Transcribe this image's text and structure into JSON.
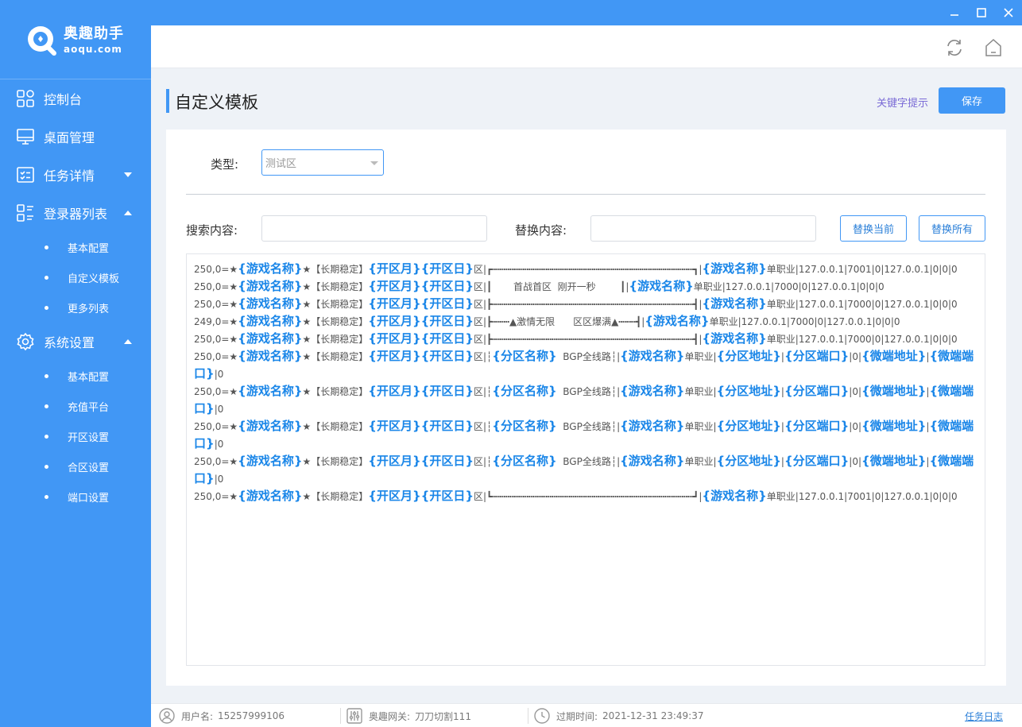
{
  "app": {
    "logo_cn": "奥趣助手",
    "logo_en": "aoqu.com"
  },
  "sidebar": {
    "items": [
      {
        "label": "控制台",
        "icon": "dashboard-icon"
      },
      {
        "label": "桌面管理",
        "icon": "monitor-icon"
      },
      {
        "label": "任务详情",
        "icon": "task-list-icon",
        "expanded": false
      },
      {
        "label": "登录器列表",
        "icon": "list-icon",
        "expanded": true,
        "children": [
          "基本配置",
          "自定义模板",
          "更多列表"
        ]
      },
      {
        "label": "系统设置",
        "icon": "gear-icon",
        "expanded": true,
        "children": [
          "基本配置",
          "充值平台",
          "开区设置",
          "合区设置",
          "端口设置"
        ]
      }
    ]
  },
  "page": {
    "title": "自定义模板",
    "keyword_hint": "关键字提示",
    "save_label": "保存"
  },
  "form": {
    "type_label": "类型:",
    "type_value": "测试区",
    "search_label": "搜索内容:",
    "search_value": "",
    "replace_label": "替换内容:",
    "replace_value": "",
    "replace_current_label": "替换当前",
    "replace_all_label": "替换所有"
  },
  "editor": {
    "lines": [
      [
        [
          "t",
          "250,0=★"
        ],
        [
          "k",
          "{游戏名称}"
        ],
        [
          "t",
          "★【长期稳定】"
        ],
        [
          "k",
          "{开区月}{开区日}"
        ],
        [
          "t",
          "区|┏┅┅┅┅┅┅┅┅┅┅┅┅┅┅┅┅┅┅┅┅┅┅┅┅┅┅┅┅┅┅┅┅┅┅┅┓|"
        ],
        [
          "k",
          "{游戏名称}"
        ],
        [
          "t",
          "单职业|127.0.0.1|7001|0|127.0.0.1|0|0|0"
        ]
      ],
      [
        [
          "t",
          "250,0=★"
        ],
        [
          "k",
          "{游戏名称}"
        ],
        [
          "t",
          "★【长期稳定】"
        ],
        [
          "k",
          "{开区月}{开区日}"
        ],
        [
          "t",
          "区|┃       首战首区  刚开一秒        ┃|"
        ],
        [
          "k",
          "{游戏名称}"
        ],
        [
          "t",
          "单职业|127.0.0.1|7000|0|127.0.0.1|0|0|0"
        ]
      ],
      [
        [
          "t",
          "250,0=★"
        ],
        [
          "k",
          "{游戏名称}"
        ],
        [
          "t",
          "★【长期稳定】"
        ],
        [
          "k",
          "{开区月}{开区日}"
        ],
        [
          "t",
          "区|┣┅┅┅┅┅┅┅┅┅┅┅┅┅┅┅┅┅┅┅┅┅┅┅┅┅┅┅┅┅┅┅┅┅┅┅┫|"
        ],
        [
          "k",
          "{游戏名称}"
        ],
        [
          "t",
          "单职业|127.0.0.1|7000|0|127.0.0.1|0|0|0"
        ]
      ],
      [
        [
          "t",
          "249,0=★"
        ],
        [
          "k",
          "{游戏名称}"
        ],
        [
          "t",
          "★【长期稳定】"
        ],
        [
          "k",
          "{开区月}{开区日}"
        ],
        [
          "t",
          "区|┣┅┅┅▲激情无限      区区爆满▲┅┅┅┫|"
        ],
        [
          "k",
          "{游戏名称}"
        ],
        [
          "t",
          "单职业|127.0.0.1|7000|0|127.0.0.1|0|0|0"
        ]
      ],
      [
        [
          "t",
          "250,0=★"
        ],
        [
          "k",
          "{游戏名称}"
        ],
        [
          "t",
          "★【长期稳定】"
        ],
        [
          "k",
          "{开区月}{开区日}"
        ],
        [
          "t",
          "区|┣┅┅┅┅┅┅┅┅┅┅┅┅┅┅┅┅┅┅┅┅┅┅┅┅┅┅┅┅┅┅┅┅┅┅┅┫|"
        ],
        [
          "k",
          "{游戏名称}"
        ],
        [
          "t",
          "单职业|127.0.0.1|7000|0|127.0.0.1|0|0|0"
        ]
      ],
      [
        [
          "t",
          "250,0=★"
        ],
        [
          "k",
          "{游戏名称}"
        ],
        [
          "t",
          "★【长期稳定】"
        ],
        [
          "k",
          "{开区月}{开区日}"
        ],
        [
          "t",
          "区|┆"
        ],
        [
          "k",
          "{分区名称}"
        ],
        [
          "t",
          "  BGP全线路┆|"
        ],
        [
          "k",
          "{游戏名称}"
        ],
        [
          "t",
          "单职业|"
        ],
        [
          "k",
          "{分区地址}"
        ],
        [
          "t",
          "|"
        ],
        [
          "k",
          "{分区端口}"
        ],
        [
          "t",
          "|0|"
        ],
        [
          "k",
          "{微端地址}"
        ],
        [
          "t",
          "|"
        ],
        [
          "k",
          "{微端端口}"
        ],
        [
          "t",
          "|0"
        ]
      ],
      [
        [
          "t",
          "250,0=★"
        ],
        [
          "k",
          "{游戏名称}"
        ],
        [
          "t",
          "★【长期稳定】"
        ],
        [
          "k",
          "{开区月}{开区日}"
        ],
        [
          "t",
          "区|┆"
        ],
        [
          "k",
          "{分区名称}"
        ],
        [
          "t",
          "  BGP全线路┆|"
        ],
        [
          "k",
          "{游戏名称}"
        ],
        [
          "t",
          "单职业|"
        ],
        [
          "k",
          "{分区地址}"
        ],
        [
          "t",
          "|"
        ],
        [
          "k",
          "{分区端口}"
        ],
        [
          "t",
          "|0|"
        ],
        [
          "k",
          "{微端地址}"
        ],
        [
          "t",
          "|"
        ],
        [
          "k",
          "{微端端口}"
        ],
        [
          "t",
          "|0"
        ]
      ],
      [
        [
          "t",
          "250,0=★"
        ],
        [
          "k",
          "{游戏名称}"
        ],
        [
          "t",
          "★【长期稳定】"
        ],
        [
          "k",
          "{开区月}{开区日}"
        ],
        [
          "t",
          "区|┆"
        ],
        [
          "k",
          "{分区名称}"
        ],
        [
          "t",
          "  BGP全线路┆|"
        ],
        [
          "k",
          "{游戏名称}"
        ],
        [
          "t",
          "单职业|"
        ],
        [
          "k",
          "{分区地址}"
        ],
        [
          "t",
          "|"
        ],
        [
          "k",
          "{分区端口}"
        ],
        [
          "t",
          "|0|"
        ],
        [
          "k",
          "{微端地址}"
        ],
        [
          "t",
          "|"
        ],
        [
          "k",
          "{微端端口}"
        ],
        [
          "t",
          "|0"
        ]
      ],
      [
        [
          "t",
          "250,0=★"
        ],
        [
          "k",
          "{游戏名称}"
        ],
        [
          "t",
          "★【长期稳定】"
        ],
        [
          "k",
          "{开区月}{开区日}"
        ],
        [
          "t",
          "区|┆"
        ],
        [
          "k",
          "{分区名称}"
        ],
        [
          "t",
          "  BGP全线路┆|"
        ],
        [
          "k",
          "{游戏名称}"
        ],
        [
          "t",
          "单职业|"
        ],
        [
          "k",
          "{分区地址}"
        ],
        [
          "t",
          "|"
        ],
        [
          "k",
          "{分区端口}"
        ],
        [
          "t",
          "|0|"
        ],
        [
          "k",
          "{微端地址}"
        ],
        [
          "t",
          "|"
        ],
        [
          "k",
          "{微端端口}"
        ],
        [
          "t",
          "|0"
        ]
      ],
      [
        [
          "t",
          "250,0=★"
        ],
        [
          "k",
          "{游戏名称}"
        ],
        [
          "t",
          "★【长期稳定】"
        ],
        [
          "k",
          "{开区月}{开区日}"
        ],
        [
          "t",
          "区|┗┅┅┅┅┅┅┅┅┅┅┅┅┅┅┅┅┅┅┅┅┅┅┅┅┅┅┅┅┅┅┅┅┅┅┅┛|"
        ],
        [
          "k",
          "{游戏名称}"
        ],
        [
          "t",
          "单职业|127.0.0.1|7001|0|127.0.0.1|0|0|0"
        ]
      ]
    ]
  },
  "footer": {
    "user_label": "用户名:",
    "user_value": "15257999106",
    "gateway_label": "奥趣网关:",
    "gateway_value": "刀刀切割111",
    "expire_label": "过期时间:",
    "expire_value": "2021-12-31 23:49:37",
    "task_log": "任务日志"
  },
  "colors": {
    "primary": "#4197f5",
    "keyword": "#1a86e8"
  }
}
